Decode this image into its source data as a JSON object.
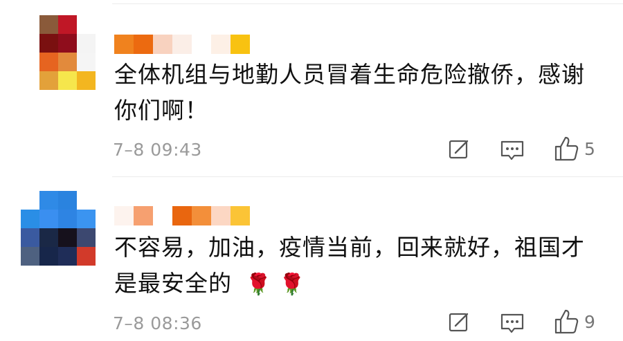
{
  "comments": [
    {
      "text": "全体机组与地勤人员冒着生命危险撤侨，感谢你们啊！",
      "time": "7–8 09:43",
      "like_count": "5",
      "avatar_colors": [
        "#8a5a3a",
        "#c01726",
        "#ffffff",
        "#ffffff",
        "#7a1010",
        "#8f0d1c",
        "#f4f4f4",
        "#ffffff",
        "#e66420",
        "#e28a3c",
        "#f5f5f5",
        "#ffffff",
        "#e3a13a",
        "#f6e64c",
        "#f3b620",
        "#ffffff"
      ]
    },
    {
      "text": "不容易，加油，疫情当前，回来就好，祖国才是最安全的",
      "emoji": "🌹 🌹",
      "time": "7–8 08:36",
      "like_count": "9",
      "avatar_colors": [
        "#ffffff",
        "#2f8ae6",
        "#2a83df",
        "#ffffff",
        "#2a8ee6",
        "#3a8ff0",
        "#2e84e3",
        "#3b94f0",
        "#3a5aa0",
        "#1a2846",
        "#16111c",
        "#3c4870",
        "#4e6180",
        "#17264a",
        "#1f2d58",
        "#d23a2a"
      ]
    }
  ]
}
